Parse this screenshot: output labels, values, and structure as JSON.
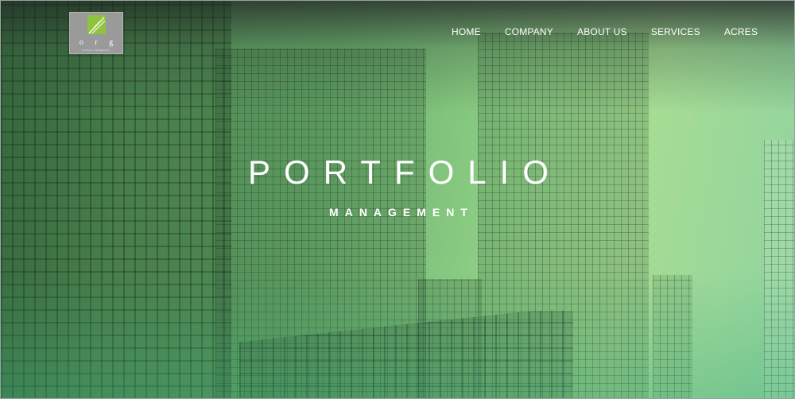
{
  "logo": {
    "mark": "o r g",
    "tagline": "portfolio management",
    "icon": "leaf-icon"
  },
  "nav": {
    "items": [
      {
        "label": "HOME"
      },
      {
        "label": "COMPANY"
      },
      {
        "label": "ABOUT US"
      },
      {
        "label": "SERVICES"
      },
      {
        "label": "ACRES"
      }
    ]
  },
  "hero": {
    "title": "PORTFOLIO",
    "subtitle": "MANAGEMENT"
  },
  "colors": {
    "accent": "#8fcf86",
    "text": "#ffffff",
    "logo_bg": "#9a9a9a",
    "leaf": "#9bcf4a"
  }
}
